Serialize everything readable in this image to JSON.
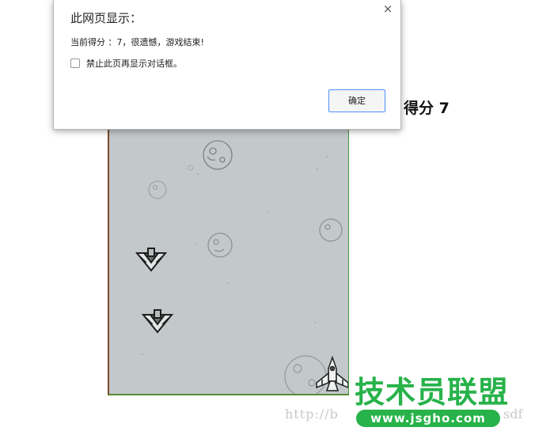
{
  "dialog": {
    "title": "此网页显示：",
    "message": "当前得分 ：7，很遗憾，游戏结束!",
    "checkbox_label": "禁止此页再显示对话框。",
    "checkbox_checked": false,
    "ok_label": "确定",
    "close_glyph": "×",
    "close_icon": "close-icon"
  },
  "game": {
    "score_text": "得分 7",
    "score": 7,
    "enemies": [
      "enemy-plane-icon",
      "enemy-plane-icon"
    ],
    "player": "player-plane-icon",
    "asteroids": [
      "asteroid-icon",
      "asteroid-icon",
      "asteroid-icon",
      "asteroid-icon",
      "asteroid-icon",
      "asteroid-icon"
    ]
  },
  "watermark": {
    "url_left": "http://b",
    "url_right": "sdf",
    "logo_text": "技术员联盟",
    "logo_url": "www.jsgho.com"
  },
  "colors": {
    "canvas_bg": "#c3c8ca",
    "logo_green": "#27b24a",
    "button_border": "#4d90fe"
  }
}
